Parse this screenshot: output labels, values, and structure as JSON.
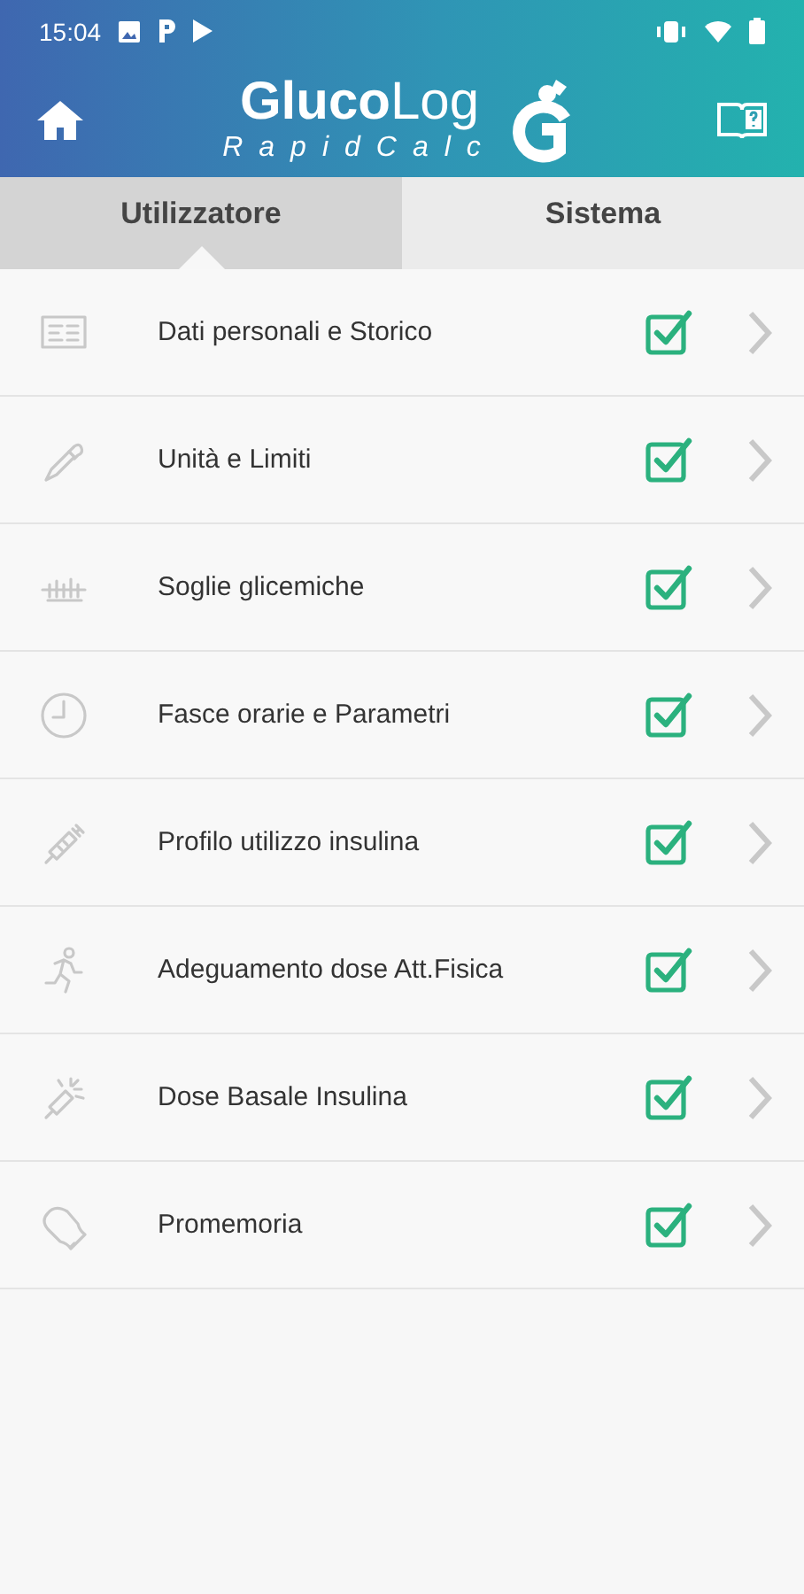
{
  "status_bar": {
    "time": "15:04"
  },
  "header": {
    "logo_title": "**Gluco**Log",
    "logo_subtitle": "RapidCalc"
  },
  "tabs": [
    {
      "label": "Utilizzatore",
      "selected": true
    },
    {
      "label": "Sistema",
      "selected": false
    }
  ],
  "items": [
    {
      "label": "Dati personali e Storico",
      "checked": true
    },
    {
      "label": "Unità e Limiti",
      "checked": true
    },
    {
      "label": "Soglie glicemiche",
      "checked": true
    },
    {
      "label": "Fasce orarie e Parametri",
      "checked": true
    },
    {
      "label": "Profilo utilizzo insulina",
      "checked": true
    },
    {
      "label": "Adeguamento dose Att.Fisica",
      "checked": true
    },
    {
      "label": "Dose Basale Insulina",
      "checked": true
    },
    {
      "label": "Promemoria",
      "checked": true
    }
  ]
}
